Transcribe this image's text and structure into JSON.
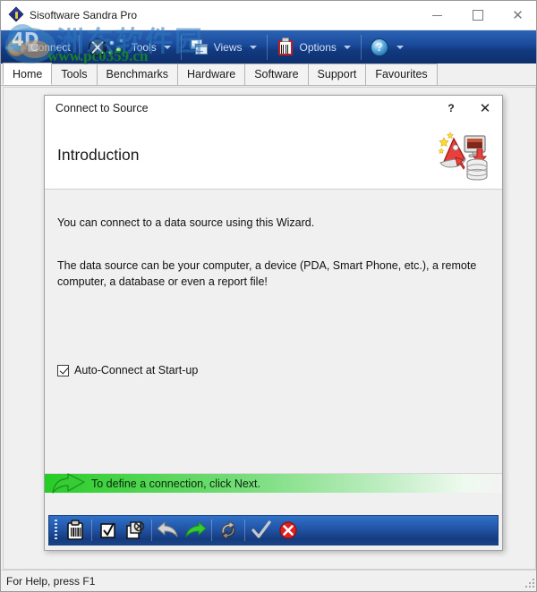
{
  "window": {
    "title": "Sisoftware Sandra Pro",
    "app_icon": "sandra-diamond-icon",
    "controls": {
      "minimize": "—",
      "maximize": "□",
      "close": "✕"
    }
  },
  "ribbon": {
    "items": [
      {
        "label": "Connect",
        "accel": "C",
        "icon": "globe-connect-icon",
        "has_caret": false
      },
      {
        "label": "Tools",
        "accel": "T",
        "icon": "crossed-tools-icon",
        "has_caret": true
      },
      {
        "label": "Views",
        "accel": "V",
        "icon": "stacked-windows-icon",
        "has_caret": true
      },
      {
        "label": "Options",
        "accel": "O",
        "icon": "clipboard-barcode-icon",
        "has_caret": true
      },
      {
        "label": "",
        "accel": "",
        "icon": "help-question-icon",
        "has_caret": true
      }
    ]
  },
  "tabs": {
    "active": "Home",
    "items": [
      "Home",
      "Tools",
      "Benchmarks",
      "Hardware",
      "Software",
      "Support",
      "Favourites"
    ]
  },
  "dialog": {
    "caption": "Connect to Source",
    "help_button": "?",
    "close_button": "✕",
    "heading": "Introduction",
    "header_icon": "wizard-hat-monitor-database-icon",
    "paragraphs": [
      "You can connect to a data source using this Wizard.",
      "The data source can be your computer, a device (PDA, Smart Phone, etc.), a remote computer, a database or even a report file!"
    ],
    "checkbox": {
      "label": "Auto-Connect at Start-up",
      "checked": true
    },
    "hint": {
      "text": "To define a connection, click Next.",
      "icon": "green-next-arrow-icon"
    },
    "toolbar": {
      "buttons": [
        {
          "name": "report-button",
          "icon": "clipboard-barcode-icon",
          "enabled": true
        },
        {
          "name": "select-all-button",
          "icon": "checkbox-checked-icon",
          "enabled": true
        },
        {
          "name": "deselect-button",
          "icon": "page-cancel-icon",
          "enabled": true
        },
        {
          "name": "back-button",
          "icon": "back-arrow-icon",
          "enabled": false
        },
        {
          "name": "next-button",
          "icon": "next-arrow-icon",
          "enabled": true
        },
        {
          "name": "refresh-button",
          "icon": "refresh-arrows-icon",
          "enabled": true
        },
        {
          "name": "ok-button",
          "icon": "checkmark-icon",
          "enabled": false
        },
        {
          "name": "cancel-button",
          "icon": "red-cancel-icon",
          "enabled": true
        }
      ]
    }
  },
  "statusbar": {
    "text": "For Help, press F1",
    "resize_grip": "resize-grip"
  },
  "watermark": {
    "chinese_text": "洲东软件园",
    "url_text": "www.pc0359.cn",
    "logo": "4d-circle-logo"
  },
  "colors": {
    "ribbon_blue": "#1b4b9c",
    "hint_green": "#25cc25",
    "dialog_bg": "#f0f0f0",
    "accent_red": "#c11f1f"
  }
}
